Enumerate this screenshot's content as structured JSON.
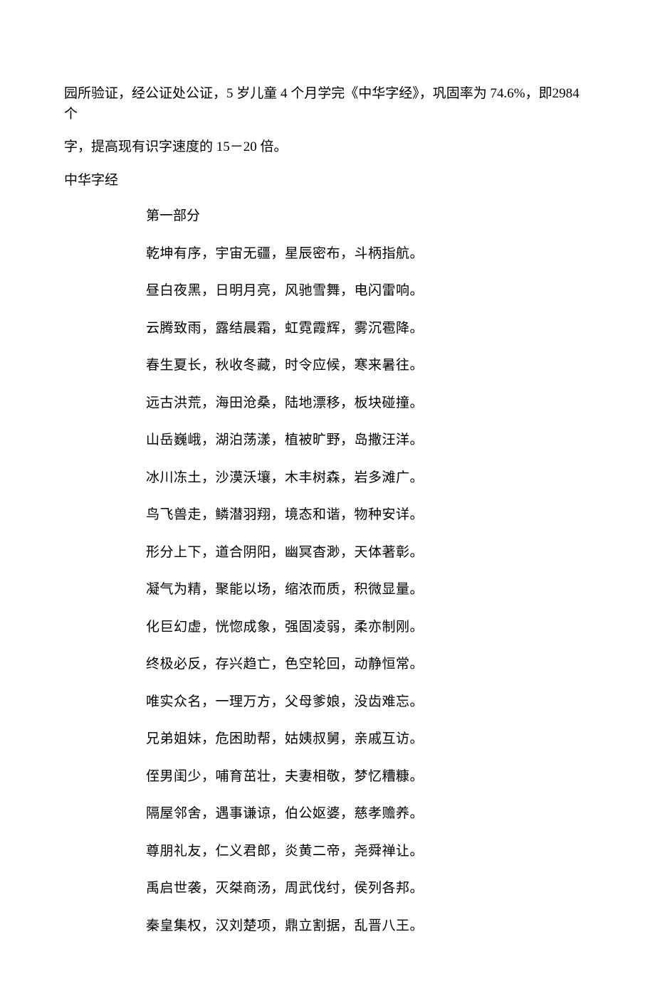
{
  "intro": {
    "p1_line1": "园所验证，经公证处公证，5 岁儿童 4 个月学完《中华字经》，巩固率为 74.6%，即2984 个",
    "p2": "字，提高现有识字速度的 15－20 倍。",
    "title": "中华字经"
  },
  "section_heading": "第一部分",
  "poem": [
    "乾坤有序，宇宙无疆，星辰密布，斗柄指航。",
    "昼白夜黑，日明月亮，风驰雪舞，电闪雷响。",
    "云腾致雨，露结晨霜，虹霓霞辉，雾沉雹降。",
    "春生夏长，秋收冬藏，时令应候，寒来暑往。",
    "远古洪荒，海田沧桑，陆地漂移，板块碰撞。",
    "山岳巍峨，湖泊荡漾，植被旷野，岛撒汪洋。",
    "冰川冻土，沙漠沃壤，木丰树森，岩多滩广。",
    "鸟飞兽走，鳞潜羽翔，境态和谐，物种安详。",
    "形分上下，道合阴阳，幽冥杳渺，天体著彰。",
    "凝气为精，聚能以场，缩浓而质，积微显量。",
    "化巨幻虚，恍惚成象，强固凌弱，柔亦制刚。",
    "终极必反，存兴趋亡，色空轮回，动静恒常。",
    "唯实众名，一理万方，父母爹娘，没齿难忘。",
    "兄弟姐妹，危困助帮，姑姨叔舅，亲戚互访。",
    "侄男闺少，哺育茁壮，夫妻相敬，梦忆糟糠。",
    "隔屋邻舍，遇事谦谅，伯公妪婆，慈孝赡养。",
    "尊朋礼友，仁义君郎，炎黄二帝，尧舜禅让。",
    "禹启世袭，灭桀商汤，周武伐纣，侯列各邦。",
    "秦皇集权，汉刘楚项，鼎立割据，乱晋八王。"
  ]
}
